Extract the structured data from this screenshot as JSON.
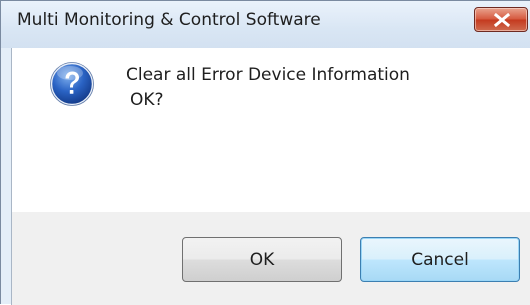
{
  "dialog": {
    "title": "Multi Monitoring & Control Software",
    "message_line1": "Clear all Error Device Information",
    "message_line2": "OK?",
    "icon": "question-icon",
    "buttons": {
      "ok_label": "OK",
      "cancel_label": "Cancel"
    }
  },
  "colors": {
    "close_button": "#d6593f",
    "focused_button_border": "#3c7fb1",
    "icon_blue": "#1f4fa8"
  }
}
